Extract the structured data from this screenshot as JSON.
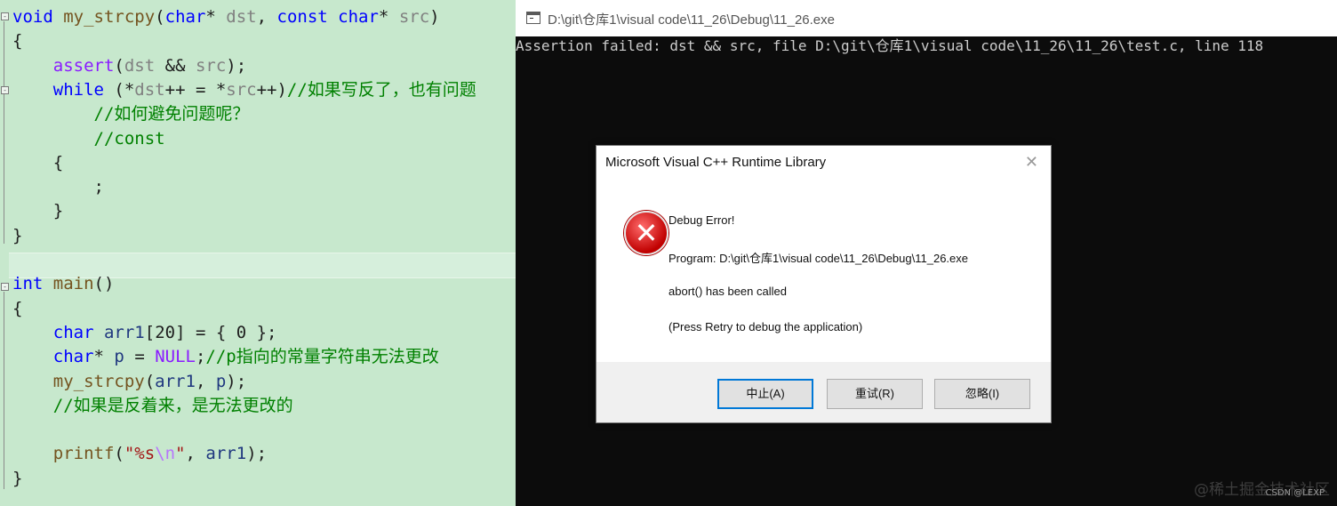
{
  "editor": {
    "lines": [
      [
        [
          "kw",
          "void"
        ],
        [
          "nm",
          " "
        ],
        [
          "fn",
          "my_strcpy"
        ],
        [
          "nm",
          "("
        ],
        [
          "kw",
          "char"
        ],
        [
          "nm",
          "* "
        ],
        [
          "pm",
          "dst"
        ],
        [
          "nm",
          ", "
        ],
        [
          "kw",
          "const"
        ],
        [
          "nm",
          " "
        ],
        [
          "kw",
          "char"
        ],
        [
          "nm",
          "* "
        ],
        [
          "pm",
          "src"
        ],
        [
          "nm",
          ")"
        ]
      ],
      [
        [
          "nm",
          "{"
        ]
      ],
      [
        [
          "nm",
          "    "
        ],
        [
          "mc",
          "assert"
        ],
        [
          "nm",
          "("
        ],
        [
          "pm",
          "dst"
        ],
        [
          "nm",
          " && "
        ],
        [
          "pm",
          "src"
        ],
        [
          "nm",
          ");"
        ]
      ],
      [
        [
          "nm",
          "    "
        ],
        [
          "kw",
          "while"
        ],
        [
          "nm",
          " (*"
        ],
        [
          "pm",
          "dst"
        ],
        [
          "nm",
          "++ = *"
        ],
        [
          "pm",
          "src"
        ],
        [
          "nm",
          "++)"
        ],
        [
          "cm",
          "//如果写反了，也有问题"
        ]
      ],
      [
        [
          "nm",
          "        "
        ],
        [
          "cm",
          "//如何避免问题呢？"
        ]
      ],
      [
        [
          "nm",
          "        "
        ],
        [
          "cm",
          "//const"
        ]
      ],
      [
        [
          "nm",
          "    {"
        ]
      ],
      [
        [
          "nm",
          "        ;"
        ]
      ],
      [
        [
          "nm",
          "    }"
        ]
      ],
      [
        [
          "nm",
          "}"
        ]
      ],
      [],
      [
        [
          "kw",
          "int"
        ],
        [
          "nm",
          " "
        ],
        [
          "fn",
          "main"
        ],
        [
          "nm",
          "()"
        ]
      ],
      [
        [
          "nm",
          "{"
        ]
      ],
      [
        [
          "nm",
          "    "
        ],
        [
          "kw",
          "char"
        ],
        [
          "nm",
          " "
        ],
        [
          "vr",
          "arr1"
        ],
        [
          "nm",
          "[20] = { 0 };"
        ]
      ],
      [
        [
          "nm",
          "    "
        ],
        [
          "kw",
          "char"
        ],
        [
          "nm",
          "* "
        ],
        [
          "vr",
          "p"
        ],
        [
          "nm",
          " = "
        ],
        [
          "mc",
          "NULL"
        ],
        [
          "nm",
          ";"
        ],
        [
          "cm",
          "//p指向的常量字符串无法更改"
        ]
      ],
      [
        [
          "nm",
          "    "
        ],
        [
          "fn",
          "my_strcpy"
        ],
        [
          "nm",
          "("
        ],
        [
          "vr",
          "arr1"
        ],
        [
          "nm",
          ", "
        ],
        [
          "vr",
          "p"
        ],
        [
          "nm",
          ");"
        ]
      ],
      [
        [
          "nm",
          "    "
        ],
        [
          "cm",
          "//如果是反着来，是无法更改的"
        ]
      ],
      [],
      [
        [
          "nm",
          "    "
        ],
        [
          "fn",
          "printf"
        ],
        [
          "nm",
          "("
        ],
        [
          "st",
          "\"%s"
        ],
        [
          "esc",
          "\\n"
        ],
        [
          "st",
          "\""
        ],
        [
          "nm",
          ", "
        ],
        [
          "vr",
          "arr1"
        ],
        [
          "nm",
          ");"
        ]
      ],
      [
        [
          "nm",
          "}"
        ]
      ]
    ]
  },
  "console": {
    "title": "D:\\git\\仓库1\\visual code\\11_26\\Debug\\11_26.exe",
    "output": "Assertion failed: dst && src, file D:\\git\\仓库1\\visual code\\11_26\\11_26\\test.c, line 118",
    "watermark": "@稀土掘金技术社区",
    "csdn": "CSDN @LEXP"
  },
  "dialog": {
    "title": "Microsoft Visual C++ Runtime Library",
    "heading": "Debug Error!",
    "program": "Program: D:\\git\\仓库1\\visual code\\11_26\\Debug\\11_26.exe",
    "abort": "abort() has been called",
    "hint": "(Press Retry to debug the application)",
    "buttons": {
      "abort": "中止(A)",
      "retry": "重试(R)",
      "ignore": "忽略(I)"
    }
  },
  "colors": {
    "editor_bg": "#c7e8cd",
    "keyword": "#0000ff",
    "comment": "#008000",
    "console_bg": "#0c0c0c",
    "console_text": "#cccccc",
    "error_red": "#c00000",
    "default_button_border": "#0078d7"
  }
}
